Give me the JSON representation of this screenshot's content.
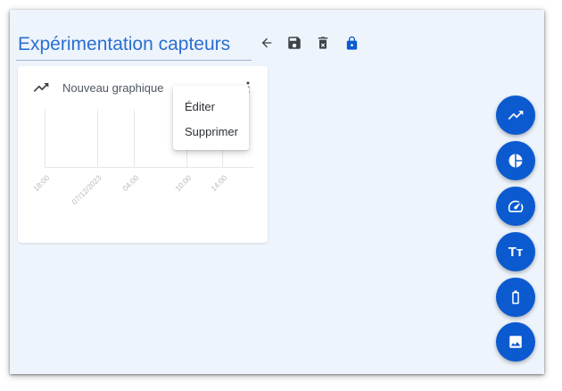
{
  "page": {
    "title": "Expérimentation capteurs"
  },
  "toolbar": {
    "back_icon": "arrow-back-icon",
    "save_icon": "save-icon",
    "delete_icon": "delete-icon",
    "lock_icon": "lock-icon"
  },
  "card": {
    "icon": "trending-up-icon",
    "title": "Nouveau graphique",
    "more_icon": "more-vert-icon",
    "x_ticks": [
      "18:00",
      "07/12/2023",
      "04:00",
      "10:00",
      "14:00"
    ]
  },
  "context_menu": {
    "items": [
      {
        "label": "Éditer"
      },
      {
        "label": "Supprimer"
      }
    ]
  },
  "fabs": [
    {
      "icon": "line-chart-icon"
    },
    {
      "icon": "pie-chart-icon"
    },
    {
      "icon": "gauge-icon"
    },
    {
      "icon": "text-icon",
      "label": "Tт"
    },
    {
      "icon": "battery-icon"
    },
    {
      "icon": "image-icon"
    }
  ],
  "colors": {
    "accent": "#0b5ad0",
    "title": "#2a6fd1",
    "background": "#eef4fc"
  }
}
